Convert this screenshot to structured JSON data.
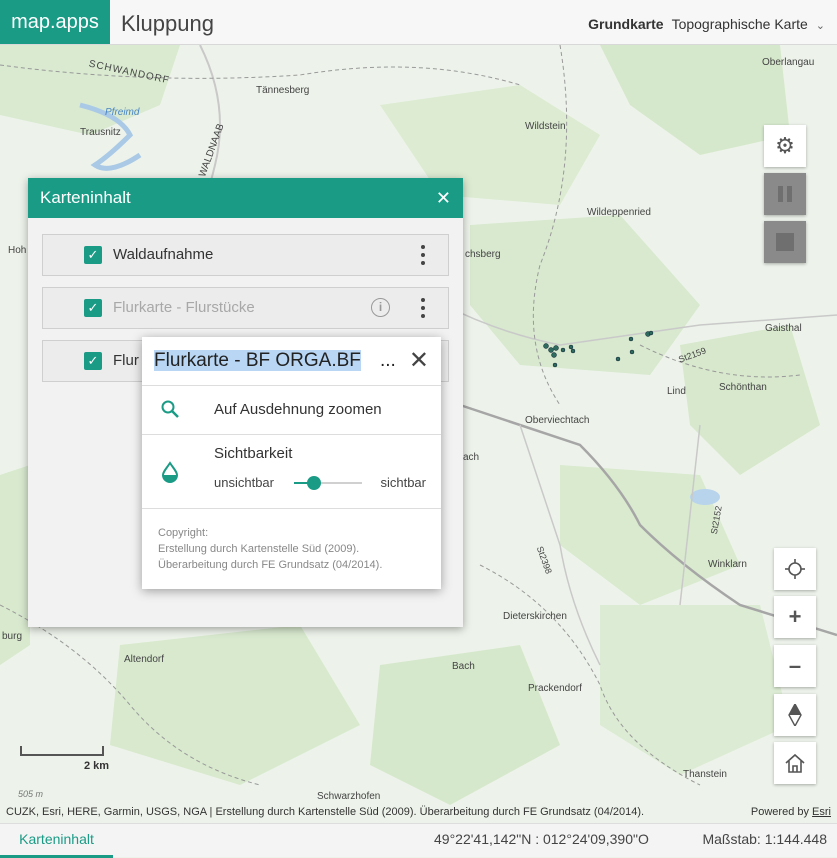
{
  "header": {
    "brand": "map.apps",
    "app_title": "Kluppung",
    "basemap_label": "Grundkarte",
    "basemap_value": "Topographische Karte"
  },
  "map_labels": [
    {
      "text": "Oberlangau"
    },
    {
      "text": "SCHWANDORF"
    },
    {
      "text": "Tännesberg"
    },
    {
      "text": "Pfreimd"
    },
    {
      "text": "Trausnitz"
    },
    {
      "text": "WALDNAAB"
    },
    {
      "text": "Wildstein"
    },
    {
      "text": "Wildeppenried"
    },
    {
      "text": "Hoh"
    },
    {
      "text": "chsberg"
    },
    {
      "text": "Gaisthal"
    },
    {
      "text": "St2159"
    },
    {
      "text": "Lind"
    },
    {
      "text": "Schönthan"
    },
    {
      "text": "Oberviechtach"
    },
    {
      "text": "ach"
    },
    {
      "text": "St2152"
    },
    {
      "text": "St2398"
    },
    {
      "text": "Winklarn"
    },
    {
      "text": "Dieterskirchen"
    },
    {
      "text": "burg"
    },
    {
      "text": "Altendorf"
    },
    {
      "text": "Bach"
    },
    {
      "text": "Prackendorf"
    },
    {
      "text": "Thanstein"
    },
    {
      "text": "Schwarzhofen"
    },
    {
      "text": "505 m"
    }
  ],
  "scalebar": {
    "label": "2 km"
  },
  "attribution": {
    "text": "CUZK, Esri, HERE, Garmin, USGS, NGA | Erstellung durch Kartenstelle Süd (2009). Überarbeitung durch FE Grundsatz (04/2014).",
    "powered_prefix": "Powered by",
    "powered_link": "Esri"
  },
  "panel": {
    "title": "Karteninhalt",
    "layers": [
      {
        "name": "Waldaufnahme",
        "checked": true,
        "dimmed": false
      },
      {
        "name": "Flurkarte - Flurstücke",
        "checked": true,
        "dimmed": true
      },
      {
        "name": "Flur",
        "checked": true,
        "dimmed": false
      }
    ]
  },
  "popup": {
    "title": "Flurkarte - BF ORGA.BF",
    "ellipsis": "...",
    "zoom_label": "Auf Ausdehnung zoomen",
    "visibility_title": "Sichtbarkeit",
    "visibility_min": "unsichtbar",
    "visibility_max": "sichtbar",
    "opacity": 0.3,
    "copyright_lines": [
      "Copyright:",
      "Erstellung durch Kartenstelle Süd (2009).",
      "Überarbeitung durch FE Grundsatz (04/2014)."
    ]
  },
  "bottom": {
    "tab": "Karteninhalt",
    "coords": "49°22'41,142\"N : 012°24'09,390\"O",
    "scale": "Maßstab: 1:144.448"
  },
  "colors": {
    "accent": "#1a9b86",
    "map_background": "#eef3ea"
  }
}
